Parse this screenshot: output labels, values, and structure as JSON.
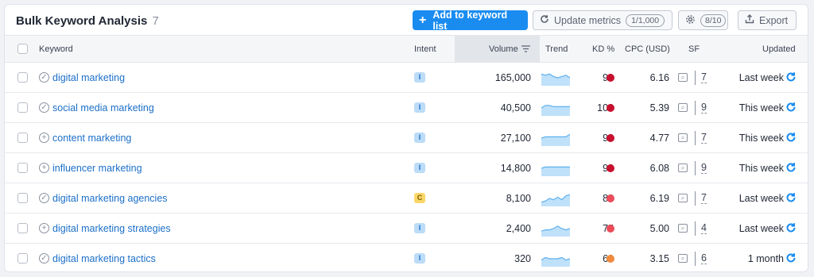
{
  "header": {
    "title": "Bulk Keyword Analysis",
    "count": "7",
    "add_button": "Add to keyword list",
    "update_button": "Update metrics",
    "update_quota": "1/1,000",
    "settings_count": "8/10",
    "export_button": "Export"
  },
  "columns": {
    "keyword": "Keyword",
    "intent": "Intent",
    "volume": "Volume",
    "trend": "Trend",
    "kd": "KD %",
    "cpc": "CPC (USD)",
    "sf": "SF",
    "updated": "Updated"
  },
  "colors": {
    "accent": "#1a8cf0",
    "link": "#1b6fc9",
    "kd_very_hard": "#c8102e",
    "kd_hard": "#ec4c5a",
    "kd_difficult": "#f08a3c"
  },
  "rows": [
    {
      "keyword": "digital marketing",
      "status_icon": "check-circle-icon",
      "intent": "I",
      "volume": "165,000",
      "trend": [
        8,
        7,
        8,
        6,
        5,
        6,
        7,
        5
      ],
      "kd": "99",
      "kd_color": "#c8102e",
      "cpc": "6.16",
      "sf": "7",
      "updated": "Last week"
    },
    {
      "keyword": "social media marketing",
      "status_icon": "check-circle-icon",
      "intent": "I",
      "volume": "40,500",
      "trend": [
        5,
        7,
        7,
        6,
        6,
        6,
        6,
        6
      ],
      "kd": "100",
      "kd_color": "#c8102e",
      "cpc": "5.39",
      "sf": "9",
      "updated": "This week"
    },
    {
      "keyword": "content marketing",
      "status_icon": "plus-circle-icon",
      "intent": "I",
      "volume": "27,100",
      "trend": [
        5,
        6,
        6,
        6,
        6,
        6,
        6,
        8
      ],
      "kd": "93",
      "kd_color": "#c8102e",
      "cpc": "4.77",
      "sf": "7",
      "updated": "This week"
    },
    {
      "keyword": "influencer marketing",
      "status_icon": "plus-circle-icon",
      "intent": "I",
      "volume": "14,800",
      "trend": [
        5,
        6,
        6,
        6,
        6,
        6,
        6,
        6
      ],
      "kd": "90",
      "kd_color": "#c8102e",
      "cpc": "6.08",
      "sf": "9",
      "updated": "This week"
    },
    {
      "keyword": "digital marketing agencies",
      "status_icon": "check-circle-icon",
      "intent": "C",
      "volume": "8,100",
      "trend": [
        2,
        3,
        5,
        4,
        6,
        4,
        7,
        8
      ],
      "kd": "83",
      "kd_color": "#ec4c5a",
      "cpc": "6.19",
      "sf": "7",
      "updated": "Last week"
    },
    {
      "keyword": "digital marketing strategies",
      "status_icon": "plus-circle-icon",
      "intent": "I",
      "volume": "2,400",
      "trend": [
        3,
        4,
        4,
        5,
        7,
        5,
        4,
        5
      ],
      "kd": "75",
      "kd_color": "#ec4c5a",
      "cpc": "5.00",
      "sf": "4",
      "updated": "Last week"
    },
    {
      "keyword": "digital marketing tactics",
      "status_icon": "check-circle-icon",
      "intent": "I",
      "volume": "320",
      "trend": [
        4,
        6,
        5,
        5,
        5,
        6,
        4,
        5
      ],
      "kd": "69",
      "kd_color": "#f08a3c",
      "cpc": "3.15",
      "sf": "6",
      "updated": "1 month"
    }
  ]
}
